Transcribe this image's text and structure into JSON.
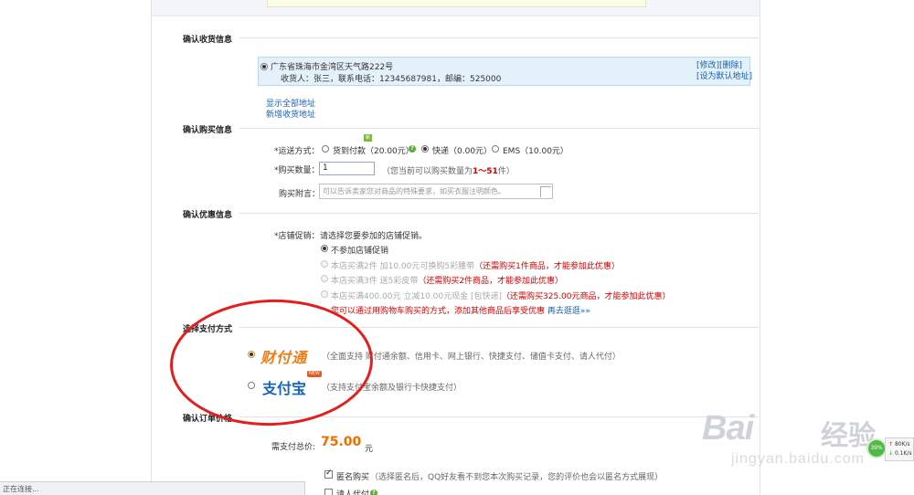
{
  "address_section": {
    "title": "确认收货信息",
    "address_line": "广东省珠海市金湾区天气路222号",
    "recipient_line": "收货人：张三，联系电话：12345687981，邮编：525000",
    "edit_link": "[修改]",
    "delete_link": "[删除]",
    "set_default_link": "[设为默认地址]",
    "show_all_link": "显示全部地址",
    "add_address_link": "新增收货地址"
  },
  "purchase_section": {
    "title": "确认购买信息",
    "shipping_label": "*运送方式：",
    "shipping_new_tag": "新",
    "shipping_options": [
      {
        "label": "货到付款（20.00元）",
        "selected": false
      },
      {
        "label": "快递（0.00元）",
        "selected": true
      },
      {
        "label": "EMS（10.00元）",
        "selected": false
      }
    ],
    "qty_label": "*购买数量：",
    "qty_value": "1",
    "qty_hint_pre": "（您当前可以购买数量为",
    "qty_hint_range": "1～51",
    "qty_hint_post": "件）",
    "note_label": "购买附言：",
    "note_placeholder": "可以告诉卖家您对商品的特殊要求，如买衣服注明颜色。"
  },
  "discount_section": {
    "title": "确认优惠信息",
    "promo_label": "*店铺促销：",
    "promo_prompt": "请选择您要参加的店铺促销。",
    "options": [
      {
        "text": "不参加店铺促销",
        "note": "",
        "selected": true,
        "disabled": false
      },
      {
        "text": "本店买满2件 加10.00元可换购5彩腰带",
        "note": "（还需购买1件商品，才能参加此优惠）",
        "selected": false,
        "disabled": true
      },
      {
        "text": "本店买满3件 送5彩皮带",
        "note": "（还需购买2件商品，才能参加此优惠）",
        "selected": false,
        "disabled": true
      },
      {
        "text": "本店买满400.00元 立减10.00元现金 [包快递]",
        "note": "（还需购买325.00元商品，才能参加此优惠）",
        "selected": false,
        "disabled": true
      }
    ],
    "footer_note": "您可以通过用购物车购买的方式，添加其他商品后享受优惠",
    "footer_link": "再去逛逛»»"
  },
  "payment_section": {
    "title": "选择支付方式",
    "methods": [
      {
        "logo": "财付通",
        "desc": "（全面支持 财付通余额、信用卡、网上银行、快捷支付、储值卡支付、请人代付）",
        "selected": true
      },
      {
        "logo": "支付宝",
        "badge": "NEW",
        "desc": "（支持支付宝余额及银行卡快捷支付）",
        "selected": false
      }
    ]
  },
  "total_section": {
    "title": "确认订单价格",
    "total_label": "需支付总价:",
    "total_value": "75.00",
    "currency": "元",
    "anonymous_label": "匿名购买",
    "anonymous_checked": true,
    "anonymous_hint": "（选择匿名后，QQ好友看不到您本次购买记录，您的评价也会以匿名方式展现）",
    "proxy_label": "请人代付"
  },
  "status_bar": {
    "text": "正在连接..."
  },
  "watermark": {
    "brand": "Bai",
    "brand_cn": "经验",
    "url": "jingyan.baidu.com"
  },
  "net_widget": {
    "percent": "39%",
    "up": "80K/s",
    "down": "0.1K/s"
  },
  "colors": {
    "link": "#1a5fb4",
    "warning": "#d40000",
    "price": "#f06c00",
    "highlight_ellipse": "#e41e1e",
    "address_bg": "#e3f1fb"
  }
}
